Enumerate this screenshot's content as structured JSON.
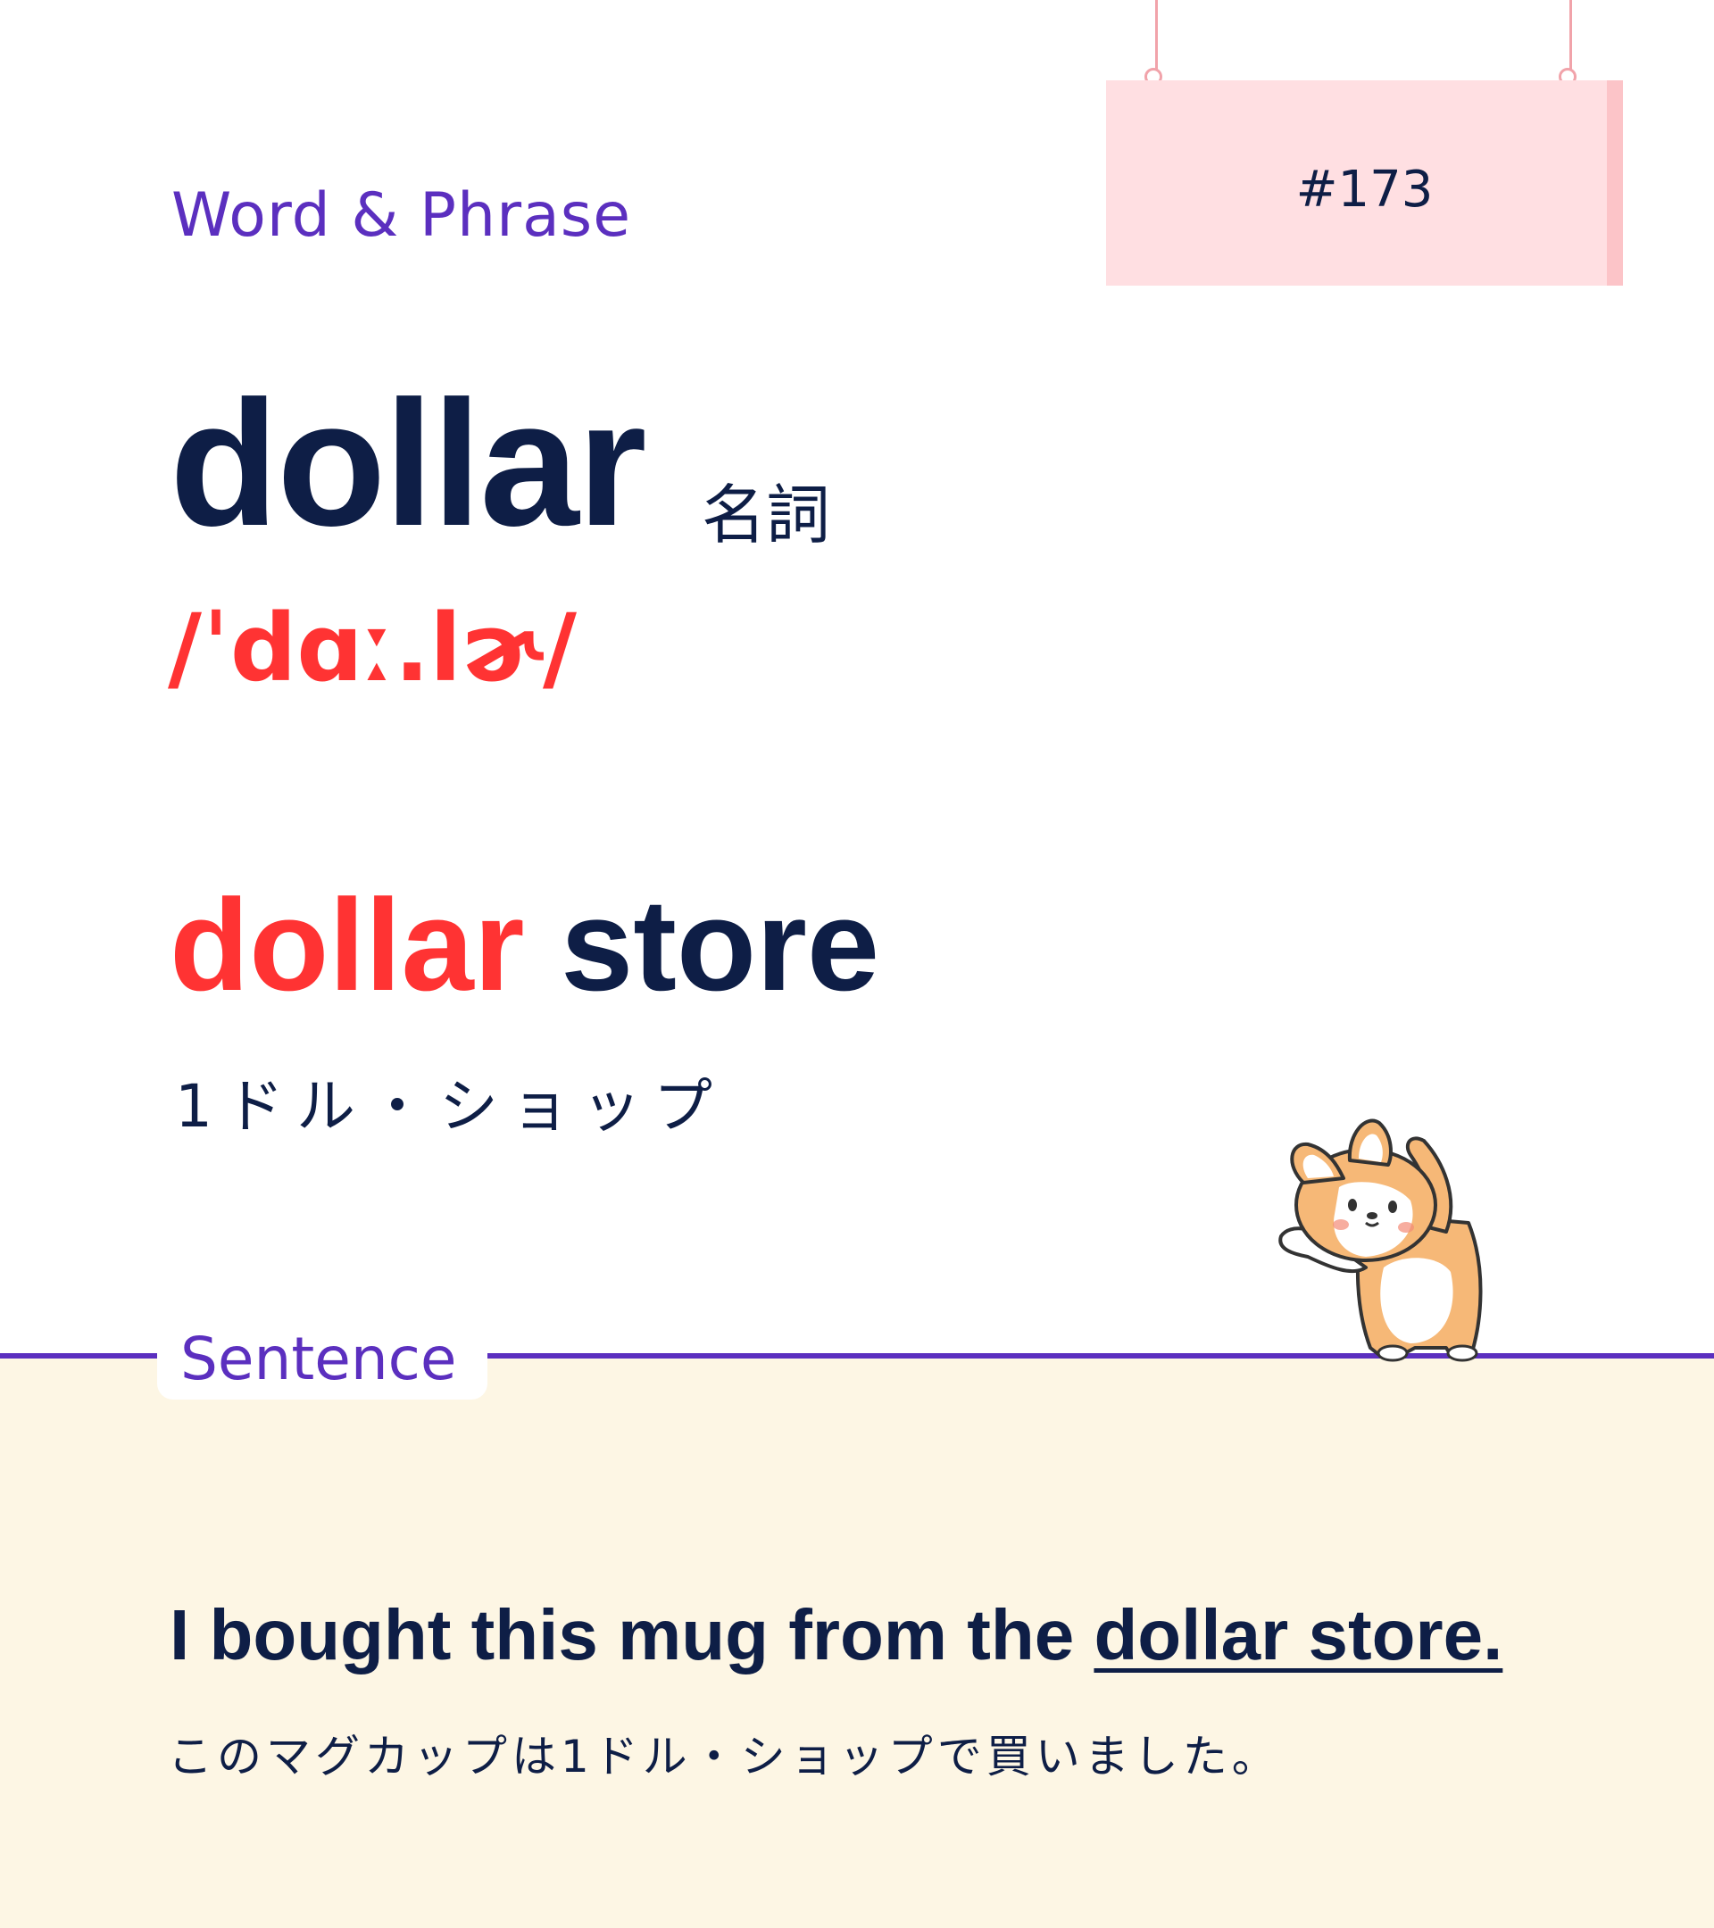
{
  "header": {
    "section_label": "Word & Phrase",
    "card_number": "#173"
  },
  "entry": {
    "word": "dollar",
    "part_of_speech": "名詞",
    "pronunciation": "/ˈdɑː.lɚ/"
  },
  "phrase": {
    "highlight": "dollar",
    "rest": "store",
    "translation": "1ドル・ショップ"
  },
  "sentence": {
    "section_label": "Sentence",
    "prefix": "I bought this mug from the ",
    "underlined": "dollar store.",
    "translation": "このマグカップは1ドル・ショップで買いました。"
  },
  "illustration": {
    "subject": "corgi-icon"
  },
  "colors": {
    "navy": "#0e1e46",
    "purple": "#5b2fbf",
    "red": "#ff3333",
    "sign_pink": "#ffdfe2",
    "cream": "#fdf6e4"
  }
}
